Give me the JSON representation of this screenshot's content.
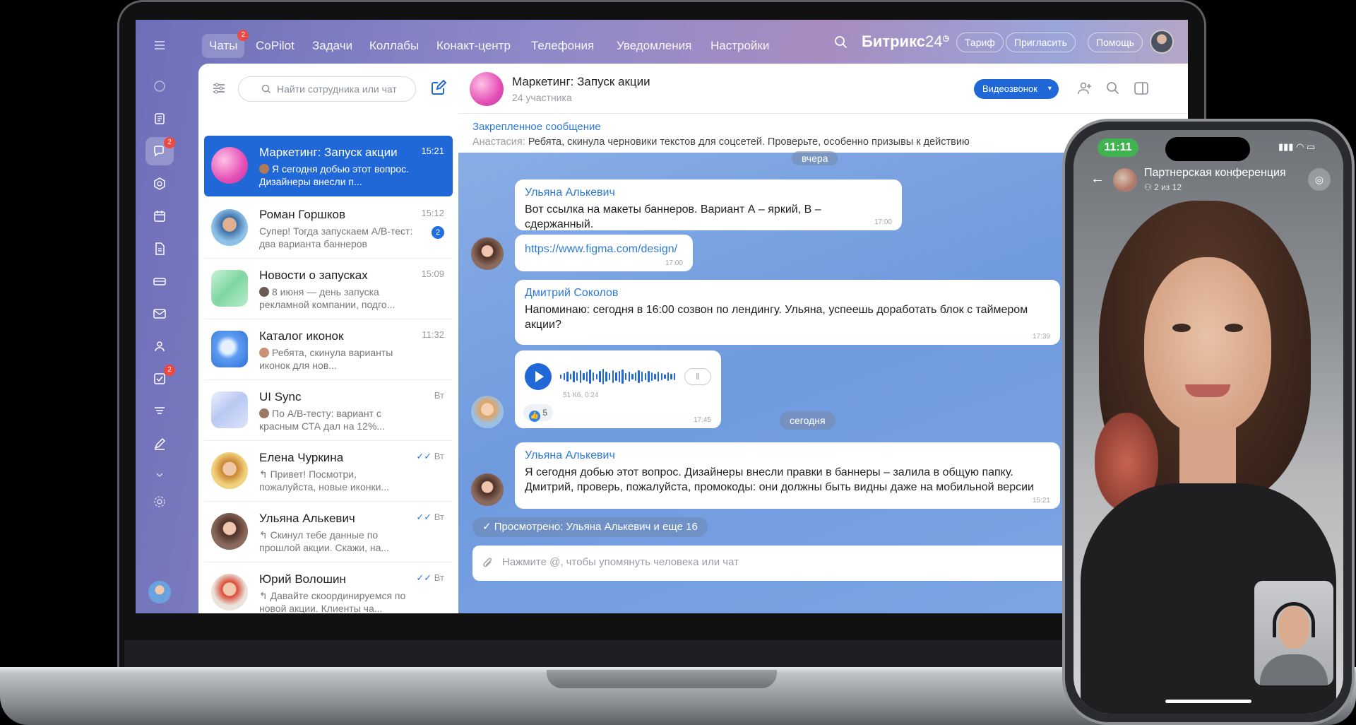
{
  "topnav": {
    "items": [
      {
        "label": "Чаты",
        "badge": "2"
      },
      {
        "label": "CoPilot"
      },
      {
        "label": "Задачи"
      },
      {
        "label": "Коллабы"
      },
      {
        "label": "Конакт-центр"
      },
      {
        "label": "Телефония"
      },
      {
        "label": "Уведомления"
      },
      {
        "label": "Настройки"
      }
    ],
    "brand": "Битрикс",
    "brand_num": "24",
    "tariff": "Тариф",
    "invite": "Пригласить",
    "help": "Помощь"
  },
  "rail": {
    "chat_badge": "2",
    "tasks_badge": "2"
  },
  "chatlist": {
    "search_placeholder": "Найти сотрудника или чат",
    "items": [
      {
        "name": "Маркетинг: Запуск акции",
        "time": "15:21",
        "snippet": "Я сегодня добью этот вопрос. Дизайнеры внесли п..."
      },
      {
        "name": "Роман Горшков",
        "time": "15:12",
        "snippet": "Супер! Тогда запускаем А/В-тест: два варианта баннеров",
        "count": "2"
      },
      {
        "name": "Новости о запусках",
        "time": "15:09",
        "snippet": "8 июня — день запуска рекламной компании, подго..."
      },
      {
        "name": "Каталог иконок",
        "time": "11:32",
        "snippet": "Ребята, скинула варианты иконок для нов..."
      },
      {
        "name": "UI Sync",
        "time": "Вт",
        "snippet": "По А/В-тесту: вариант с красным СТА дал на 12%..."
      },
      {
        "name": "Елена Чуркина",
        "time": "Вт",
        "snippet": "↰ Привет! Посмотри, пожалуйста, новые иконки..."
      },
      {
        "name": "Ульяна Алькевич",
        "time": "Вт",
        "snippet": "↰ Скинул тебе данные по прошлой акции. Скажи, на..."
      },
      {
        "name": "Юрий Волошин",
        "time": "Вт",
        "snippet": "↰ Давайте скоординируемся по новой акции. Клиенты ча..."
      }
    ]
  },
  "chat": {
    "title": "Маркетинг: Запуск акции",
    "subtitle": "24 участника",
    "video_button": "Видеозвонок",
    "pinned_label": "Закрепленное сообщение",
    "pinned_author": "Анастасия:",
    "pinned_text": "Ребята, скинула черновики текстов для соцсетей. Проверьте, особенно призывы к действию",
    "sep_yesterday": "вчера",
    "sep_today": "сегодня",
    "messages": [
      {
        "author": "Ульяна Алькевич",
        "text": "Вот ссылка на макеты баннеров. Вариант А – яркий, В – сдержанный.",
        "time": "17:00"
      },
      {
        "text": "https://www.figma.com/design/",
        "time": "17:00"
      },
      {
        "author": "Дмитрий Соколов",
        "text": "Напоминаю: сегодня в 16:00 созвон по лендингу. Ульяна, успеешь доработать блок с таймером акции?",
        "time": "17:39"
      },
      {
        "voice_meta": "51 Кб, 0:24",
        "reaction": "5",
        "time": "17:45"
      },
      {
        "author": "Ульяна Алькевич",
        "text": "Я сегодня добью этот вопрос. Дизайнеры внесли правки в баннеры – залила в общую папку. Дмитрий, проверь, пожалуйста, промокоды: они должны быть видны даже на мобильной версии",
        "time": "15:21"
      }
    ],
    "seen": "Просмотрено: Ульяна Алькевич и еще 16",
    "input_placeholder": "Нажмите @, чтобы упомянуть человека или чат"
  },
  "phone": {
    "time": "11:11",
    "title": "Партнерская конференция",
    "subtitle": "2 из 12"
  }
}
